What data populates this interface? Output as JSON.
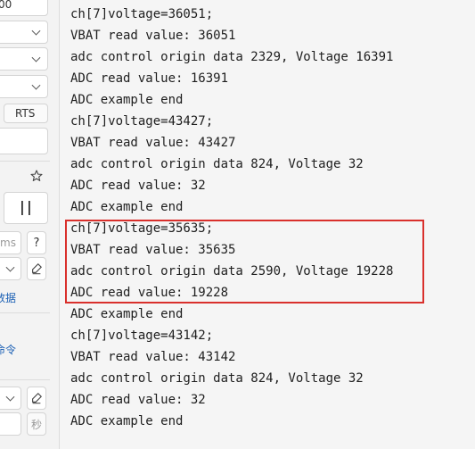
{
  "left_panel": {
    "baud_partial": "00",
    "rts_label": "RTS",
    "star_icon": "star-icon",
    "pause_icon": "pause-icon",
    "ms_partial": "ms",
    "help_label": "?",
    "brush_icon": "brush-icon",
    "data_link_partial": "数据",
    "command_link_partial": "命令",
    "sec_partial": "秒"
  },
  "terminal": {
    "lines": [
      "ch[7]voltage=36051;",
      "VBAT read value: 36051",
      "adc control origin data 2329, Voltage 16391",
      "ADC read value: 16391",
      "ADC example end",
      "ch[7]voltage=43427;",
      "VBAT read value: 43427",
      "adc control origin data 824, Voltage 32",
      "ADC read value: 32",
      "ADC example end",
      "ch[7]voltage=35635;",
      "VBAT read value: 35635",
      "adc control origin data 2590, Voltage 19228",
      "ADC read value: 19228",
      "ADC example end",
      "ch[7]voltage=43142;",
      "VBAT read value: 43142",
      "adc control origin data 824, Voltage 32",
      "ADC read value: 32",
      "ADC example end"
    ],
    "highlight_color": "#d9302c"
  }
}
